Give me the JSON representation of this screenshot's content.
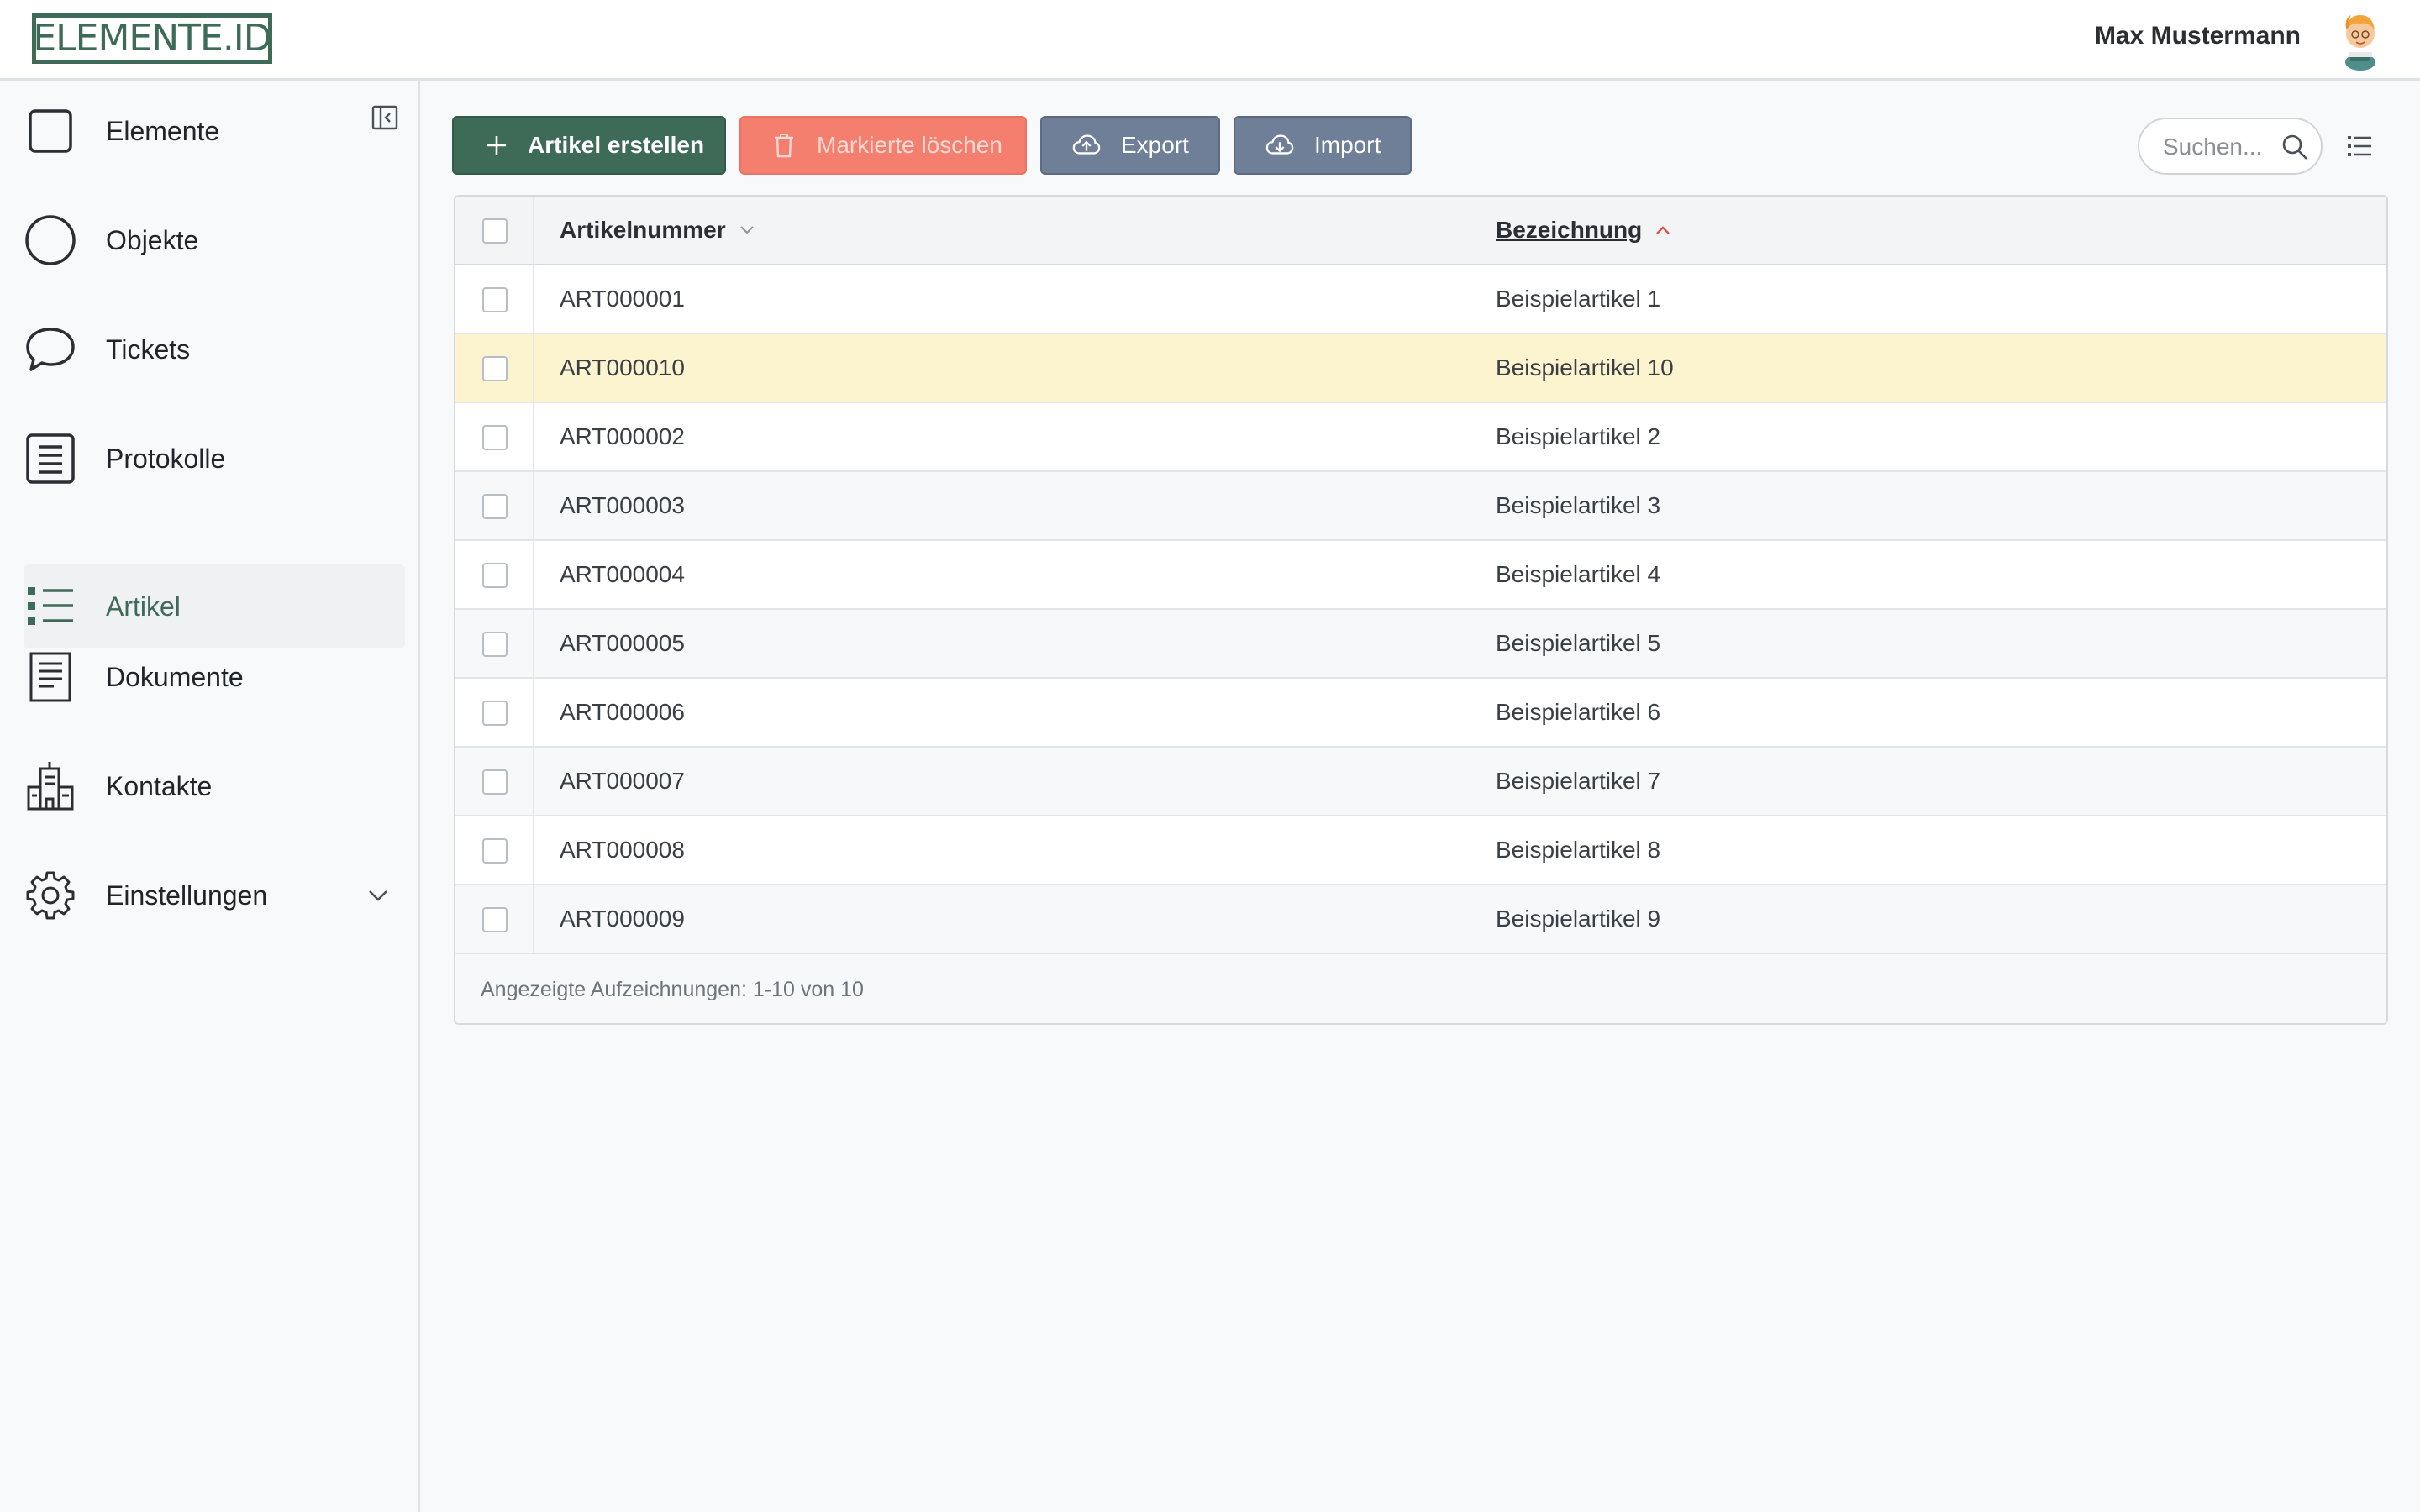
{
  "header": {
    "logo_text": "ELEMENTE.ID",
    "user_name": "Max Mustermann"
  },
  "sidebar": {
    "items": [
      {
        "label": "Elemente",
        "icon": "square-icon",
        "active": false
      },
      {
        "label": "Objekte",
        "icon": "circle-icon",
        "active": false
      },
      {
        "label": "Tickets",
        "icon": "chat-bubble-icon",
        "active": false
      },
      {
        "label": "Protokolle",
        "icon": "document-list-icon",
        "active": false
      },
      {
        "label": "Artikel",
        "icon": "bullet-list-icon",
        "active": true
      },
      {
        "label": "Dokumente",
        "icon": "document-icon",
        "active": false
      },
      {
        "label": "Kontakte",
        "icon": "buildings-icon",
        "active": false
      },
      {
        "label": "Einstellungen",
        "icon": "gear-icon",
        "active": false
      }
    ]
  },
  "toolbar": {
    "create_label": "Artikel erstellen",
    "delete_label": "Markierte löschen",
    "export_label": "Export",
    "import_label": "Import",
    "search_placeholder": "Suchen..."
  },
  "table": {
    "columns": [
      "Artikelnummer",
      "Bezeichnung"
    ],
    "sorted_column": "Bezeichnung",
    "sort_direction": "ascending",
    "rows": [
      {
        "artikelnummer": "ART000001",
        "bezeichnung": "Beispielartikel 1",
        "highlighted": false
      },
      {
        "artikelnummer": "ART000010",
        "bezeichnung": "Beispielartikel 10",
        "highlighted": true
      },
      {
        "artikelnummer": "ART000002",
        "bezeichnung": "Beispielartikel 2",
        "highlighted": false
      },
      {
        "artikelnummer": "ART000003",
        "bezeichnung": "Beispielartikel 3",
        "highlighted": false
      },
      {
        "artikelnummer": "ART000004",
        "bezeichnung": "Beispielartikel 4",
        "highlighted": false
      },
      {
        "artikelnummer": "ART000005",
        "bezeichnung": "Beispielartikel 5",
        "highlighted": false
      },
      {
        "artikelnummer": "ART000006",
        "bezeichnung": "Beispielartikel 6",
        "highlighted": false
      },
      {
        "artikelnummer": "ART000007",
        "bezeichnung": "Beispielartikel 7",
        "highlighted": false
      },
      {
        "artikelnummer": "ART000008",
        "bezeichnung": "Beispielartikel 8",
        "highlighted": false
      },
      {
        "artikelnummer": "ART000009",
        "bezeichnung": "Beispielartikel 9",
        "highlighted": false
      }
    ],
    "footer": "Angezeigte Aufzeichnungen: 1-10 von 10"
  },
  "colors": {
    "brand": "#3d6b58",
    "danger": "#f47f6f",
    "secondary": "#6f7f97",
    "highlight_row": "#fcf3cf",
    "sort_active": "#d9534f"
  }
}
